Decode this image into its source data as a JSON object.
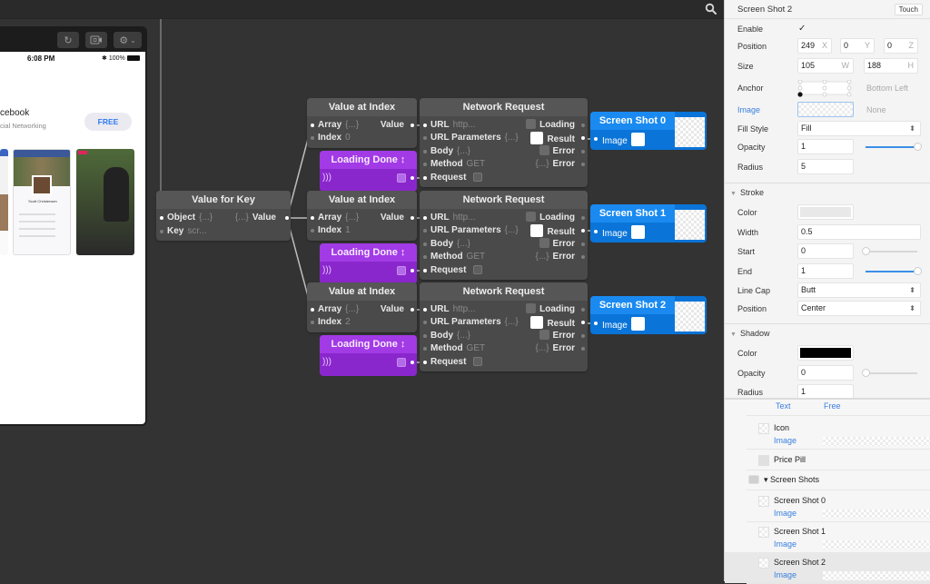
{
  "canvas": {
    "search_icon": "search-icon"
  },
  "simulator": {
    "toolbar": {
      "reload_icon": "reload-icon",
      "record_icon": "video-camera-icon",
      "settings_icon": "gear-icon"
    },
    "status_bar": {
      "time": "6:08 PM",
      "bluetooth": "✱",
      "battery": "100%"
    },
    "app": {
      "name": "cebook",
      "category": "cial Networking",
      "price_button": "FREE",
      "profile_name": "Scott Christensen"
    }
  },
  "nodes": {
    "value_for_key": {
      "title": "Value for Key",
      "inputs": [
        {
          "label": "Object",
          "hint": "{...}"
        },
        {
          "label": "Key",
          "hint": "scr..."
        }
      ],
      "output": {
        "label": "Value",
        "hint": "{...}"
      }
    },
    "groups": [
      {
        "value_at_index": {
          "title": "Value at Index",
          "inputs": [
            {
              "label": "Array",
              "hint": "{...}"
            },
            {
              "label": "Index",
              "hint": "0"
            }
          ],
          "output": "Value"
        },
        "loading_done": {
          "title": "Loading Done ↕"
        },
        "network_request": {
          "title": "Network Request",
          "inputs": [
            {
              "label": "URL",
              "hint": "http..."
            },
            {
              "label": "URL Parameters",
              "hint": "{...}"
            },
            {
              "label": "Body",
              "hint": "{...}"
            },
            {
              "label": "Method",
              "hint": "GET"
            },
            {
              "label": "Request",
              "hint": ""
            }
          ],
          "outputs": [
            {
              "label": "Loading",
              "hint": ""
            },
            {
              "label": "Result",
              "hint": ""
            },
            {
              "label": "Error",
              "hint": ""
            },
            {
              "label": "Error",
              "hint": "{...}"
            }
          ]
        },
        "screen_shot": {
          "title": "Screen Shot 0",
          "input": "Image"
        }
      },
      {
        "value_at_index": {
          "title": "Value at Index",
          "inputs": [
            {
              "label": "Array",
              "hint": "{...}"
            },
            {
              "label": "Index",
              "hint": "1"
            }
          ],
          "output": "Value"
        },
        "loading_done": {
          "title": "Loading Done ↕"
        },
        "network_request": {
          "title": "Network Request",
          "inputs": [
            {
              "label": "URL",
              "hint": "http..."
            },
            {
              "label": "URL Parameters",
              "hint": "{...}"
            },
            {
              "label": "Body",
              "hint": "{...}"
            },
            {
              "label": "Method",
              "hint": "GET"
            },
            {
              "label": "Request",
              "hint": ""
            }
          ],
          "outputs": [
            {
              "label": "Loading",
              "hint": ""
            },
            {
              "label": "Result",
              "hint": ""
            },
            {
              "label": "Error",
              "hint": ""
            },
            {
              "label": "Error",
              "hint": "{...}"
            }
          ]
        },
        "screen_shot": {
          "title": "Screen Shot 1",
          "input": "Image"
        }
      },
      {
        "value_at_index": {
          "title": "Value at Index",
          "inputs": [
            {
              "label": "Array",
              "hint": "{...}"
            },
            {
              "label": "Index",
              "hint": "2"
            }
          ],
          "output": "Value"
        },
        "loading_done": {
          "title": "Loading Done ↕"
        },
        "network_request": {
          "title": "Network Request",
          "inputs": [
            {
              "label": "URL",
              "hint": "http..."
            },
            {
              "label": "URL Parameters",
              "hint": "{...}"
            },
            {
              "label": "Body",
              "hint": "{...}"
            },
            {
              "label": "Method",
              "hint": "GET"
            },
            {
              "label": "Request",
              "hint": ""
            }
          ],
          "outputs": [
            {
              "label": "Loading",
              "hint": ""
            },
            {
              "label": "Result",
              "hint": ""
            },
            {
              "label": "Error",
              "hint": ""
            },
            {
              "label": "Error",
              "hint": "{...}"
            }
          ]
        },
        "screen_shot": {
          "title": "Screen Shot 2",
          "input": "Image"
        }
      }
    ]
  },
  "inspector": {
    "title": "Screen Shot 2",
    "touch_button": "Touch",
    "enable": {
      "label": "Enable",
      "value": "✓"
    },
    "position": {
      "label": "Position",
      "x": "249",
      "y": "0",
      "z": "0",
      "x_unit": "X",
      "y_unit": "Y",
      "z_unit": "Z"
    },
    "size": {
      "label": "Size",
      "w": "105",
      "h": "188",
      "w_unit": "W",
      "h_unit": "H"
    },
    "anchor": {
      "label": "Anchor",
      "value": "Bottom Left"
    },
    "image": {
      "label": "Image",
      "value": "None"
    },
    "fill_style": {
      "label": "Fill Style",
      "value": "Fill"
    },
    "opacity": {
      "label": "Opacity",
      "value": "1",
      "slider_fraction": 1.0
    },
    "radius": {
      "label": "Radius",
      "value": "5"
    },
    "stroke": {
      "title": "Stroke",
      "color": {
        "label": "Color",
        "value": "#e8e8e8"
      },
      "width": {
        "label": "Width",
        "value": "0.5"
      },
      "start": {
        "label": "Start",
        "value": "0",
        "slider_fraction": 0.0
      },
      "end": {
        "label": "End",
        "value": "1",
        "slider_fraction": 1.0
      },
      "line_cap": {
        "label": "Line Cap",
        "value": "Butt"
      },
      "position": {
        "label": "Position",
        "value": "Center"
      }
    },
    "shadow": {
      "title": "Shadow",
      "color": {
        "label": "Color",
        "value": "#000000"
      },
      "opacity": {
        "label": "Opacity",
        "value": "0",
        "slider_fraction": 0.0
      },
      "radius": {
        "label": "Radius",
        "value": "1"
      }
    }
  },
  "layers": {
    "partial_row": {
      "prop": "Text",
      "value": "Free"
    },
    "items": [
      {
        "name": "Icon",
        "sub": "Image",
        "kind": "image"
      },
      {
        "name": "Price Pill",
        "sub": "",
        "kind": "rect"
      },
      {
        "name": "▾ Screen Shots",
        "sub": "",
        "kind": "group"
      },
      {
        "name": "Screen Shot 0",
        "sub": "Image",
        "kind": "image"
      },
      {
        "name": "Screen Shot 1",
        "sub": "Image",
        "kind": "image"
      },
      {
        "name": "Screen Shot 2",
        "sub": "Image",
        "kind": "image",
        "selected": true
      }
    ]
  },
  "colors": {
    "canvas_bg": "#333333",
    "node_bg": "#4a4a4a",
    "interaction_purple": "#8a27cc",
    "layer_blue": "#0a74d8",
    "link_blue": "#3a7fe0"
  }
}
